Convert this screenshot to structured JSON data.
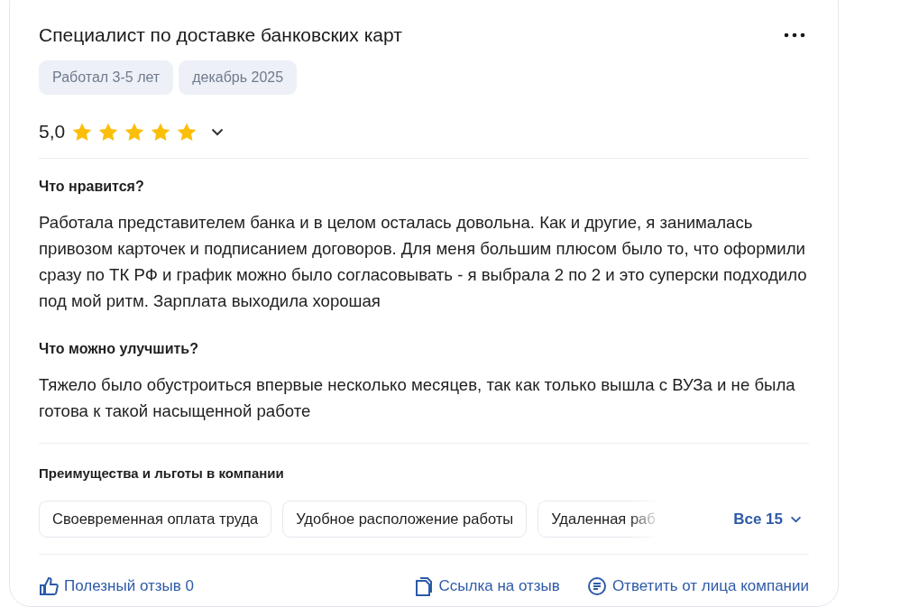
{
  "review": {
    "title": "Специалист по доставке банковских карт",
    "tags": [
      "Работал 3-5 лет",
      "декабрь 2025"
    ],
    "rating": {
      "value": "5,0",
      "stars": 5
    },
    "sections": [
      {
        "heading": "Что нравится?",
        "text": "Работала представителем банка и в целом осталась довольна. Как и другие, я занималась привозом карточек и подписанием договоров. Для меня большим плюсом было то, что оформили сразу по ТК РФ и график можно было согласовывать - я выбрала 2 по 2 и это суперски подходило под мой ритм. Зарплата выходила хорошая"
      },
      {
        "heading": "Что можно улучшить?",
        "text": "Тяжело было обустроиться впервые несколько месяцев, так как только вышла с ВУЗа и не была готова к такой насыщенной работе"
      }
    ],
    "benefits": {
      "heading": "Преимущества и льготы в компании",
      "items": [
        {
          "label": "Своевременная оплата труда",
          "faded": false
        },
        {
          "label": "Удобное расположение работы",
          "faded": false
        },
        {
          "label": "Удаленная раб",
          "faded": true
        }
      ],
      "more": "Все 15"
    },
    "actions": [
      {
        "kind": "like",
        "label": "Полезный отзыв 0"
      },
      {
        "kind": "link",
        "label": "Ссылка на отзыв"
      },
      {
        "kind": "reply",
        "label": "Ответить от лица компании"
      }
    ]
  }
}
